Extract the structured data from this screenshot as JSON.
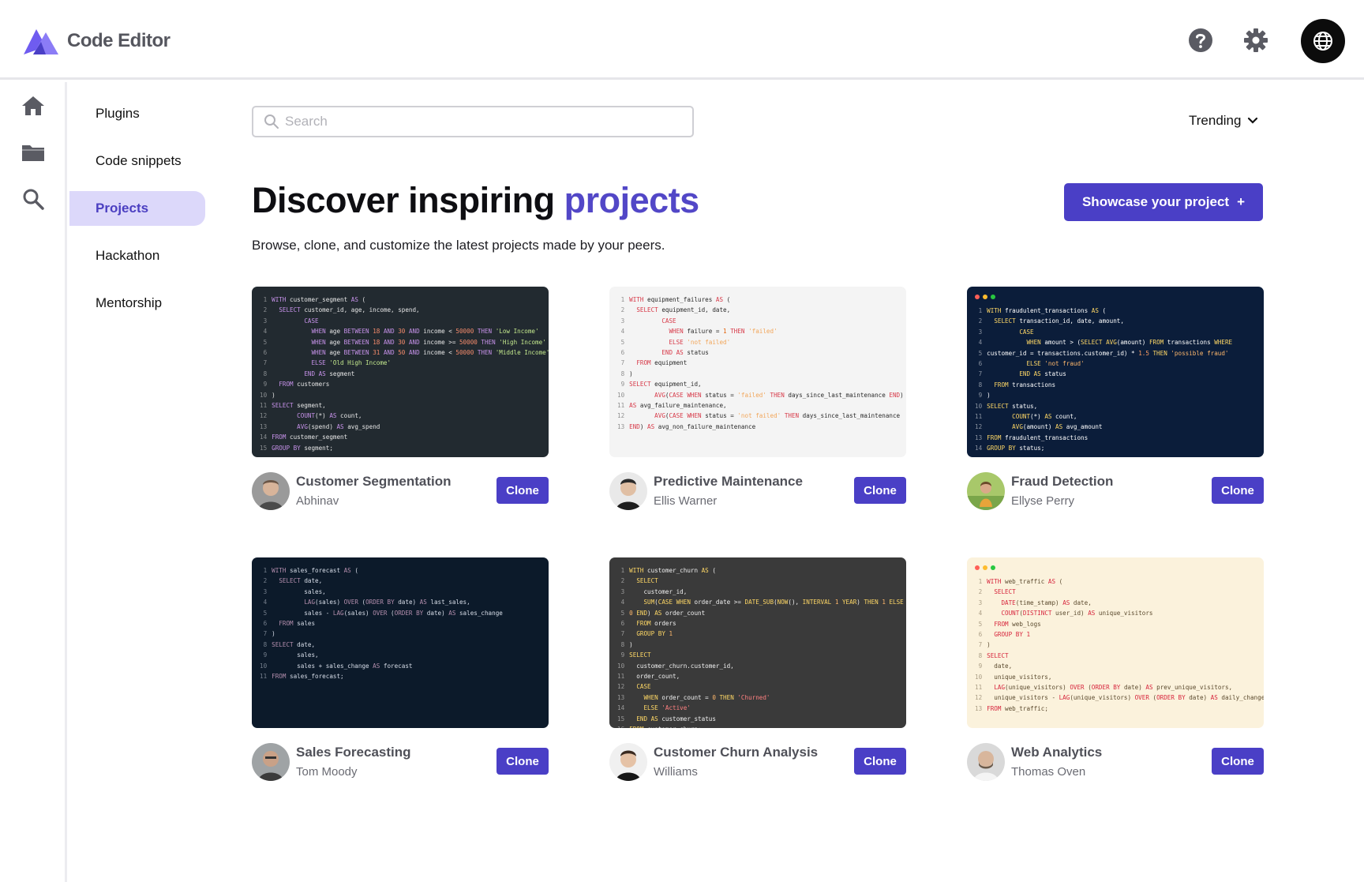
{
  "app": {
    "brand": "Code Editor"
  },
  "header": {
    "help_icon": "help-icon",
    "settings_icon": "gear-icon",
    "globe_icon": "globe-icon"
  },
  "rail": {
    "items": [
      "home-icon",
      "folder-icon",
      "search-icon"
    ]
  },
  "subnav": {
    "items": [
      {
        "label": "Plugins",
        "active": false
      },
      {
        "label": "Code snippets",
        "active": false
      },
      {
        "label": "Projects",
        "active": true
      },
      {
        "label": "Hackathon",
        "active": false
      },
      {
        "label": "Mentorship",
        "active": false
      }
    ]
  },
  "search": {
    "placeholder": "Search",
    "value": ""
  },
  "sort": {
    "label": "Trending"
  },
  "hero": {
    "title_prefix": "Discover inspiring ",
    "title_accent": "projects",
    "subtitle": "Browse, clone, and customize the latest projects made by your peers.",
    "cta_label": "Showcase your project",
    "cta_icon": "+"
  },
  "colors": {
    "accent": "#4a3fc6",
    "active_bg": "#dcd8fa"
  },
  "projects": [
    {
      "title": "Customer Segmentation",
      "author": "Abhinav",
      "clone_label": "Clone",
      "theme": {
        "bg": "#222a30",
        "fg": "#e6e6e6",
        "kw": "#c792ea",
        "str": "#c3e88d",
        "num": "#f78c6c",
        "win": false
      },
      "code": [
        "WITH customer_segment AS (",
        "  SELECT customer_id, age, income, spend,",
        "         CASE",
        "           WHEN age BETWEEN 18 AND 30 AND income < 50000 THEN 'Low Income'",
        "           WHEN age BETWEEN 18 AND 30 AND income >= 50000 THEN 'High Income'",
        "           WHEN age BETWEEN 31 AND 50 AND income < 50000 THEN 'Middle Income'",
        "           ELSE 'Old High Income'",
        "         END AS segment",
        "  FROM customers",
        ")",
        "SELECT segment,",
        "       COUNT(*) AS count,",
        "       AVG(spend) AS avg_spend",
        "FROM customer_segment",
        "GROUP BY segment;"
      ]
    },
    {
      "title": "Predictive Maintenance",
      "author": "Ellis Warner",
      "clone_label": "Clone",
      "theme": {
        "bg": "#f4f4f4",
        "fg": "#2a2a2a",
        "kw": "#d73a49",
        "str": "#f2a65a",
        "num": "#e36209",
        "win": false
      },
      "code": [
        "WITH equipment_failures AS (",
        "  SELECT equipment_id, date,",
        "         CASE",
        "           WHEN failure = 1 THEN 'failed'",
        "           ELSE 'not failed'",
        "         END AS status",
        "  FROM equipment",
        ")",
        "SELECT equipment_id,",
        "       AVG(CASE WHEN status = 'failed' THEN days_since_last_maintenance END)",
        "AS avg_failure_maintenance,",
        "       AVG(CASE WHEN status = 'not failed' THEN days_since_last_maintenance",
        "END) AS avg_non_failure_maintenance"
      ]
    },
    {
      "title": "Fraud Detection",
      "author": "Ellyse Perry",
      "clone_label": "Clone",
      "theme": {
        "bg": "#0b1d3a",
        "fg": "#ffffff",
        "kw": "#ffd866",
        "str": "#ffb86c",
        "num": "#ff9e64",
        "win": true
      },
      "code": [
        "WITH fraudulent_transactions AS (",
        "  SELECT transaction_id, date, amount,",
        "         CASE",
        "           WHEN amount > (SELECT AVG(amount) FROM transactions WHERE",
        "customer_id = transactions.customer_id) * 1.5 THEN 'possible fraud'",
        "           ELSE 'not fraud'",
        "         END AS status",
        "  FROM transactions",
        ")",
        "SELECT status,",
        "       COUNT(*) AS count,",
        "       AVG(amount) AS avg_amount",
        "FROM fraudulent_transactions",
        "GROUP BY status;"
      ]
    },
    {
      "title": "Sales Forecasting",
      "author": "Tom Moody",
      "clone_label": "Clone",
      "theme": {
        "bg": "#0c1a2a",
        "fg": "#d8dee9",
        "kw": "#b48ead",
        "str": "#a3be8c",
        "num": "#d08770",
        "win": false
      },
      "code": [
        "WITH sales_forecast AS (",
        "  SELECT date,",
        "         sales,",
        "         LAG(sales) OVER (ORDER BY date) AS last_sales,",
        "         sales - LAG(sales) OVER (ORDER BY date) AS sales_change",
        "  FROM sales",
        ")",
        "SELECT date,",
        "       sales,",
        "       sales + sales_change AS forecast",
        "FROM sales_forecast;"
      ]
    },
    {
      "title": "Customer Churn Analysis",
      "author": "Williams",
      "clone_label": "Clone",
      "theme": {
        "bg": "#3a3a3a",
        "fg": "#f0f0f0",
        "kw": "#ffd866",
        "str": "#ff8080",
        "num": "#ffb86c",
        "win": false
      },
      "code": [
        "WITH customer_churn AS (",
        "  SELECT",
        "    customer_id,",
        "    SUM(CASE WHEN order_date >= DATE_SUB(NOW(), INTERVAL 1 YEAR) THEN 1 ELSE",
        "0 END) AS order_count",
        "  FROM orders",
        "  GROUP BY 1",
        ")",
        "SELECT",
        "  customer_churn.customer_id,",
        "  order_count,",
        "  CASE",
        "    WHEN order_count = 0 THEN 'Churned'",
        "    ELSE 'Active'",
        "  END AS customer_status",
        "FROM customer_churn;"
      ]
    },
    {
      "title": "Web Analytics",
      "author": "Thomas Oven",
      "clone_label": "Clone",
      "theme": {
        "bg": "#fbf2dc",
        "fg": "#5b4a2e",
        "kw": "#d7263d",
        "str": "#8a6bbf",
        "num": "#d7263d",
        "win": true
      },
      "code": [
        "WITH web_traffic AS (",
        "  SELECT",
        "    DATE(time_stamp) AS date,",
        "    COUNT(DISTINCT user_id) AS unique_visitors",
        "  FROM web_logs",
        "  GROUP BY 1",
        ")",
        "SELECT",
        "  date,",
        "  unique_visitors,",
        "  LAG(unique_visitors) OVER (ORDER BY date) AS prev_unique_visitors,",
        "  unique_visitors - LAG(unique_visitors) OVER (ORDER BY date) AS daily_change",
        "FROM web_traffic;"
      ]
    }
  ]
}
